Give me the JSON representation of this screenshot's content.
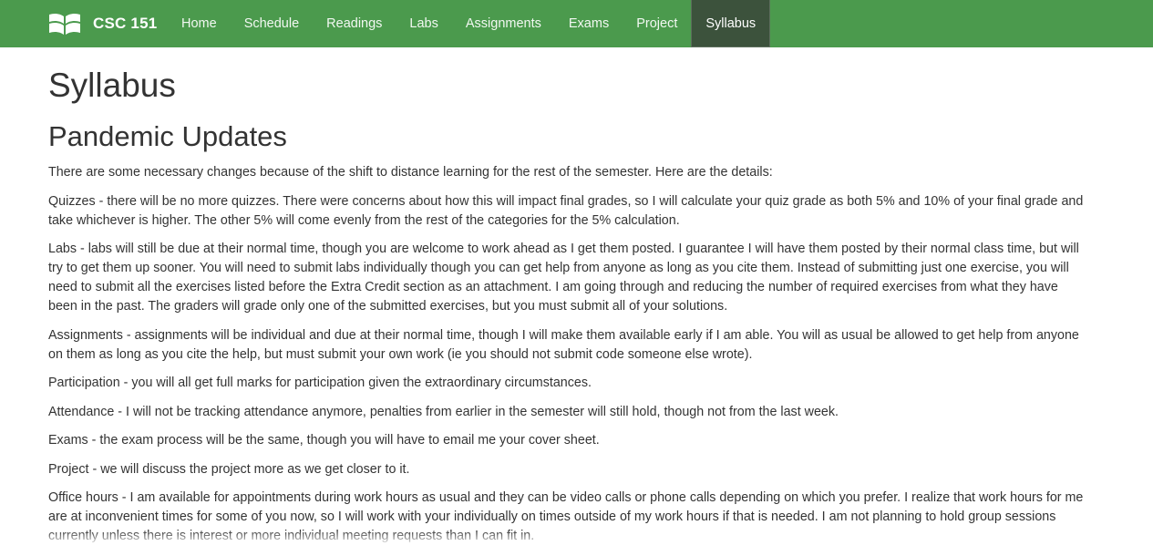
{
  "navbar": {
    "brand": "CSC 151",
    "items": [
      {
        "label": "Home"
      },
      {
        "label": "Schedule"
      },
      {
        "label": "Readings"
      },
      {
        "label": "Labs"
      },
      {
        "label": "Assignments"
      },
      {
        "label": "Exams"
      },
      {
        "label": "Project"
      },
      {
        "label": "Syllabus",
        "active": true
      }
    ],
    "color": "#4b9a4d",
    "active_color": "#3c523c",
    "brand_icon": "book-icon"
  },
  "page": {
    "title": "Syllabus",
    "section_title": "Pandemic Updates",
    "paragraphs": [
      "There are some necessary changes because of the shift to distance learning for the rest of the semester. Here are the details:",
      "Quizzes - there will be no more quizzes. There were concerns about how this will impact final grades, so I will calculate your quiz grade as both 5% and 10% of your final grade and take whichever is higher. The other 5% will come evenly from the rest of the categories for the 5% calculation.",
      "Labs - labs will still be due at their normal time, though you are welcome to work ahead as I get them posted. I guarantee I will have them posted by their normal class time, but will try to get them up sooner. You will need to submit labs individually though you can get help from anyone as long as you cite them. Instead of submitting just one exercise, you will need to submit all the exercises listed before the Extra Credit section as an attachment. I am going through and reducing the number of required exercises from what they have been in the past. The graders will grade only one of the submitted exercises, but you must submit all of your solutions.",
      "Assignments - assignments will be individual and due at their normal time, though I will make them available early if I am able. You will as usual be allowed to get help from anyone on them as long as you cite the help, but must submit your own work (ie you should not submit code someone else wrote).",
      "Participation - you will all get full marks for participation given the extraordinary circumstances.",
      "Attendance - I will not be tracking attendance anymore, penalties from earlier in the semester will still hold, though not from the last week.",
      "Exams - the exam process will be the same, though you will have to email me your cover sheet.",
      "Project - we will discuss the project more as we get closer to it.",
      "Office hours - I am available for appointments during work hours as usual and they can be video calls or phone calls depending on which you prefer. I realize that work hours for me are at inconvenient times for some of you now, so I will work with your individually on times outside of my work hours if that is needed. I am not planning to hold group sessions currently unless there is interest or more individual meeting requests than I can fit in."
    ]
  }
}
